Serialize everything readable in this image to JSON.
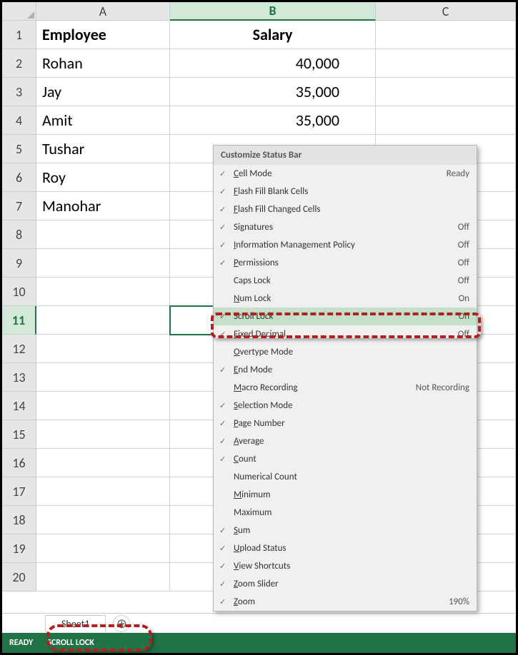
{
  "columns": [
    "A",
    "B",
    "C"
  ],
  "rows": [
    1,
    2,
    3,
    4,
    5,
    6,
    7,
    8,
    9,
    10,
    11,
    12,
    13,
    14,
    15,
    16,
    17,
    18,
    19,
    20
  ],
  "headerRow": {
    "a": "Employee",
    "b": "Salary"
  },
  "dataRows": [
    {
      "a": "Rohan",
      "b": "40,000"
    },
    {
      "a": "Jay",
      "b": "35,000"
    },
    {
      "a": "Amit",
      "b": "35,000"
    },
    {
      "a": "Tushar",
      "b": ""
    },
    {
      "a": "Roy",
      "b": ""
    },
    {
      "a": "Manohar",
      "b": ""
    }
  ],
  "activeColumn": "B",
  "activeRow": 11,
  "sheetTab": "Sheet1",
  "statusBar": {
    "ready": "READY",
    "scrollLock": "SCROLL LOCK"
  },
  "contextMenu": {
    "title": "Customize Status Bar",
    "items": [
      {
        "checked": true,
        "label": "Cell Mode",
        "accel": "C",
        "value": "Ready"
      },
      {
        "checked": true,
        "label": "Flash Fill Blank Cells",
        "accel": "F",
        "value": ""
      },
      {
        "checked": true,
        "label": "Flash Fill Changed Cells",
        "accel": "F",
        "value": ""
      },
      {
        "checked": true,
        "label": "Signatures",
        "accel": "",
        "value": "Off"
      },
      {
        "checked": true,
        "label": "Information Management Policy",
        "accel": "I",
        "value": "Off"
      },
      {
        "checked": true,
        "label": "Permissions",
        "accel": "P",
        "value": "Off"
      },
      {
        "checked": false,
        "label": "Caps Lock",
        "accel": "",
        "value": "Off"
      },
      {
        "checked": false,
        "label": "Num Lock",
        "accel": "N",
        "value": "On"
      },
      {
        "checked": true,
        "label": "Scroll Lock",
        "accel": "",
        "value": "On",
        "highlighted": true
      },
      {
        "checked": true,
        "label": "Fixed Decimal",
        "accel": "F",
        "value": "Off"
      },
      {
        "checked": false,
        "label": "Overtype Mode",
        "accel": "O",
        "value": ""
      },
      {
        "checked": true,
        "label": "End Mode",
        "accel": "E",
        "value": ""
      },
      {
        "checked": false,
        "label": "Macro Recording",
        "accel": "M",
        "value": "Not Recording"
      },
      {
        "checked": true,
        "label": "Selection Mode",
        "accel": "S",
        "value": ""
      },
      {
        "checked": true,
        "label": "Page Number",
        "accel": "P",
        "value": ""
      },
      {
        "checked": true,
        "label": "Average",
        "accel": "A",
        "value": ""
      },
      {
        "checked": true,
        "label": "Count",
        "accel": "C",
        "value": ""
      },
      {
        "checked": false,
        "label": "Numerical Count",
        "accel": "",
        "value": ""
      },
      {
        "checked": false,
        "label": "Minimum",
        "accel": "M",
        "value": ""
      },
      {
        "checked": false,
        "label": "Maximum",
        "accel": "",
        "value": ""
      },
      {
        "checked": true,
        "label": "Sum",
        "accel": "S",
        "value": ""
      },
      {
        "checked": true,
        "label": "Upload Status",
        "accel": "U",
        "value": ""
      },
      {
        "checked": true,
        "label": "View Shortcuts",
        "accel": "V",
        "value": ""
      },
      {
        "checked": true,
        "label": "Zoom Slider",
        "accel": "Z",
        "value": ""
      },
      {
        "checked": true,
        "label": "Zoom",
        "accel": "Z",
        "value": "190%"
      }
    ]
  }
}
